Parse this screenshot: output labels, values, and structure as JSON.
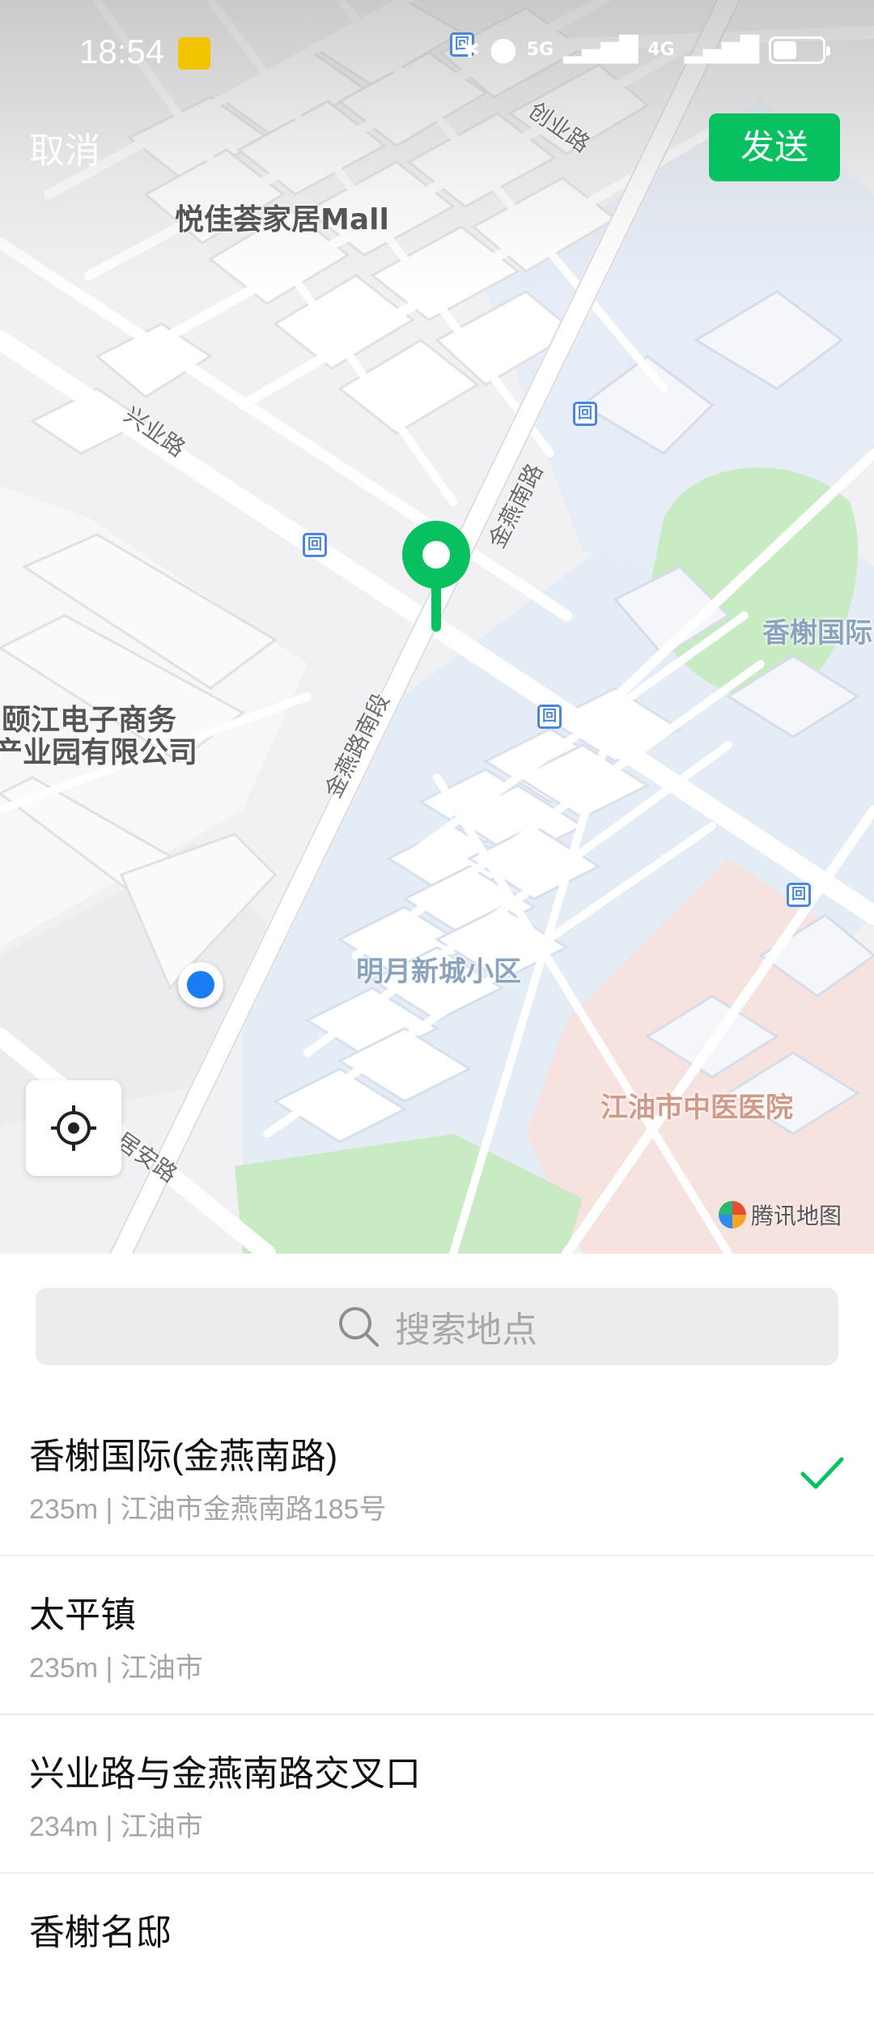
{
  "status_bar": {
    "time": "18:54",
    "network_5g": "5G",
    "network_4g": "4G"
  },
  "header": {
    "cancel_label": "取消",
    "send_label": "发送"
  },
  "map": {
    "poi_labels": [
      "悦佳荟家居Mall",
      "颐江电子商务",
      "产业园有限公司",
      "明月新城小区",
      "江油市中医医院",
      "香榭国际"
    ],
    "road_labels": [
      "创业路",
      "兴业路",
      "金燕南路",
      "金燕路南段",
      "居安路"
    ],
    "bus_stop_glyph": "回",
    "attribution": "腾讯地图"
  },
  "search": {
    "placeholder": "搜索地点"
  },
  "locations": [
    {
      "title": "香榭国际(金燕南路)",
      "subtitle": "235m | 江油市金燕南路185号",
      "selected": true
    },
    {
      "title": "太平镇",
      "subtitle": "235m | 江油市",
      "selected": false
    },
    {
      "title": "兴业路与金燕南路交叉口",
      "subtitle": "234m | 江油市",
      "selected": false
    },
    {
      "title": "香榭名邸",
      "subtitle": "",
      "selected": false
    }
  ],
  "colors": {
    "accent": "#07c160",
    "user_location": "#1a7cf2",
    "bus_stop": "#4b86d8"
  }
}
